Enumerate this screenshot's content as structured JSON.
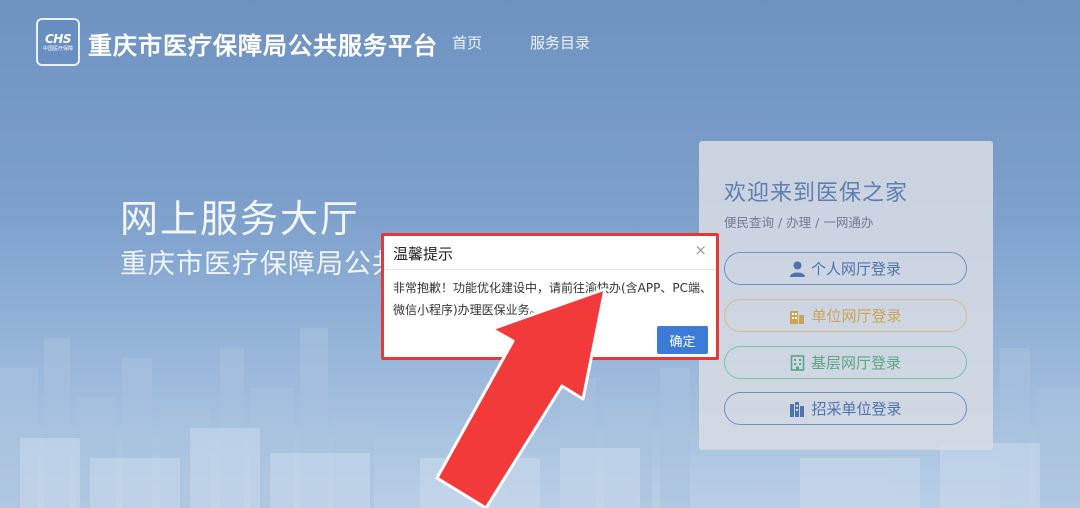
{
  "header": {
    "logo_mark": "CHS",
    "logo_sub": "中国医疗保障",
    "site_title": "重庆市医疗保障局公共服务平台",
    "nav": [
      "首页",
      "服务目录"
    ]
  },
  "hero": {
    "title": "网上服务大厅",
    "subtitle": "重庆市医疗保障局公共"
  },
  "login_panel": {
    "title": "欢迎来到医保之家",
    "subtitle": "便民查询 / 办理 / 一网通办",
    "buttons": [
      {
        "label": "个人网厅登录",
        "icon": "person-icon"
      },
      {
        "label": "单位网厅登录",
        "icon": "building-icon"
      },
      {
        "label": "基层网厅登录",
        "icon": "office-icon"
      },
      {
        "label": "招采单位登录",
        "icon": "warehouse-icon"
      }
    ]
  },
  "dialog": {
    "title": "温馨提示",
    "close_glyph": "×",
    "message": "非常抱歉！功能优化建设中，请前往渝快办(含APP、PC端、微信小程序)办理医保业务。",
    "ok_label": "确定"
  },
  "colors": {
    "accent": "#3c7bd6",
    "highlight_border": "#e53935",
    "arrow": "#f23a3a"
  }
}
